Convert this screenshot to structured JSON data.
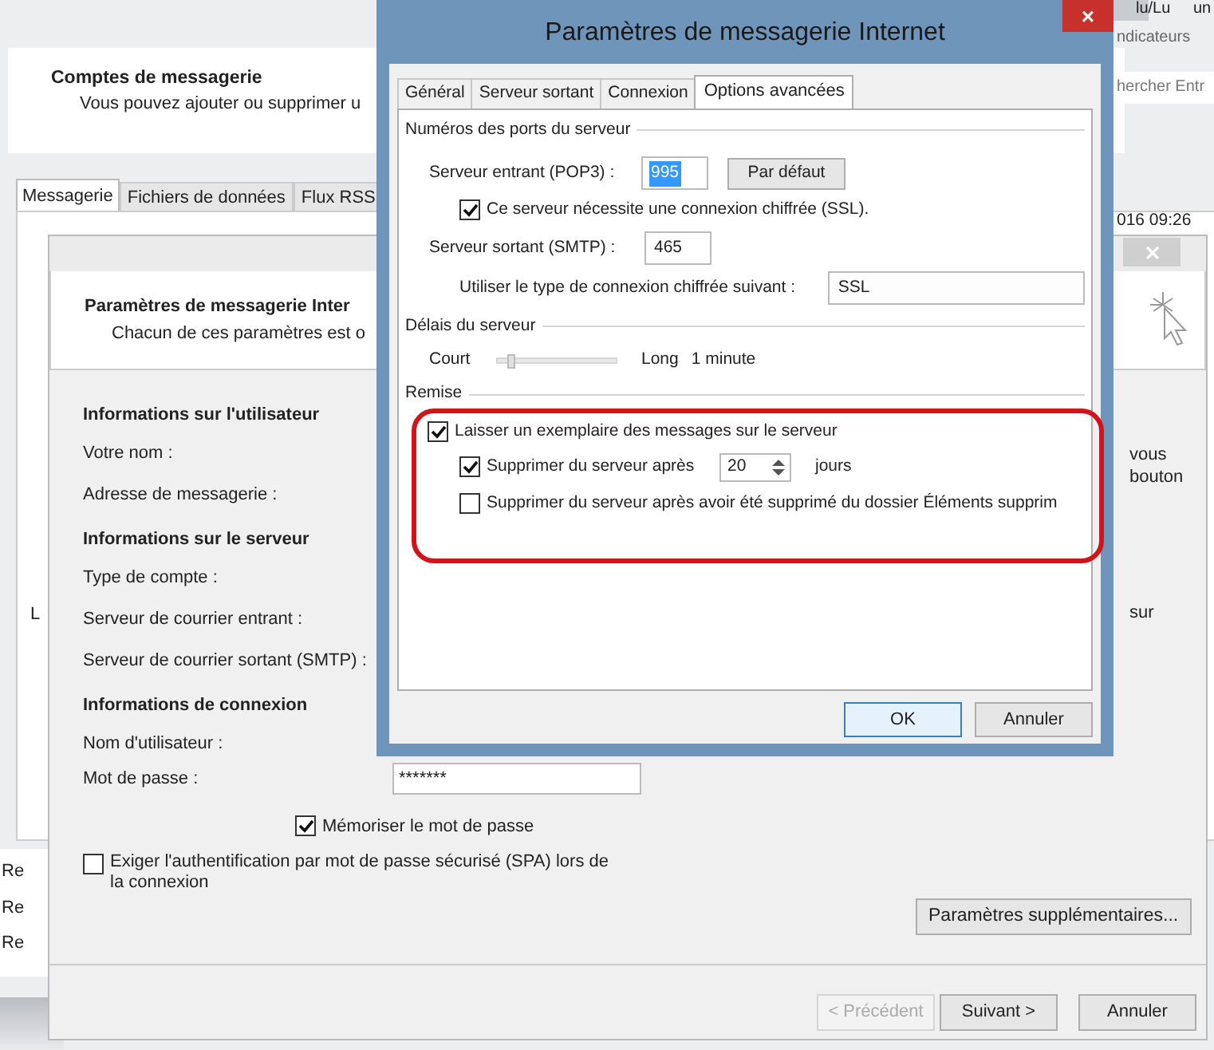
{
  "background_window": {
    "title": "Comptes de messagerie",
    "subtitle": "Vous pouvez ajouter ou supprimer u",
    "tabs": [
      {
        "label": "Messagerie",
        "selected": true
      },
      {
        "label": "Fichiers de données",
        "selected": false
      },
      {
        "label": "Flux RSS",
        "selected": false
      }
    ],
    "top_right": {
      "text_1": "lu/Lu",
      "text_2": "un",
      "text_3": "ndicateurs",
      "search_fragment": "hercher Entr",
      "date_fragment": "016 09:26"
    },
    "left_fragments": [
      "L"
    ],
    "list_fragments": [
      "Re",
      "Re",
      "Re"
    ]
  },
  "wizard": {
    "title": "Paramètres de messagerie Inter",
    "subtitle": "Chacun de ces paramètres est o",
    "sections": [
      {
        "heading": "Informations sur l'utilisateur",
        "labels": [
          "Votre nom :",
          "Adresse de messagerie :"
        ]
      },
      {
        "heading": "Informations sur le serveur",
        "labels": [
          "Type de compte :",
          "Serveur de courrier entrant :",
          "Serveur de courrier sortant (SMTP) :"
        ]
      },
      {
        "heading": "Informations de connexion",
        "labels": [
          "Nom d'utilisateur :"
        ]
      }
    ],
    "password": {
      "label": "Mot de passe :",
      "value": "*******"
    },
    "remember": {
      "label": "Mémoriser le mot de passe",
      "checked": true
    },
    "spa": {
      "label": "Exiger l'authentification par mot de passe sécurisé (SPA) lors de la connexion",
      "checked": false
    },
    "right_fragments": [
      "vous",
      "bouton",
      "sur"
    ],
    "more_settings_button": "Paramètres supplémentaires...",
    "buttons": [
      {
        "label": "< Précédent",
        "disabled": true
      },
      {
        "label": "Suivant >",
        "disabled": false
      },
      {
        "label": "Annuler",
        "disabled": false
      }
    ]
  },
  "dialog": {
    "title": "Paramètres de messagerie Internet",
    "close": "×",
    "tabs": [
      {
        "label": "Général",
        "selected": false
      },
      {
        "label": "Serveur sortant",
        "selected": false
      },
      {
        "label": "Connexion",
        "selected": false
      },
      {
        "label": "Options avancées",
        "selected": true
      }
    ],
    "ports": {
      "group": "Numéros des ports du serveur",
      "incoming_label": "Serveur entrant (POP3) :",
      "incoming_value": "995",
      "default_button": "Par défaut",
      "ssl": {
        "label": "Ce serveur nécessite une connexion chiffrée (SSL).",
        "checked": true
      },
      "outgoing_label": "Serveur sortant (SMTP) :",
      "outgoing_value": "465",
      "encryption_label": "Utiliser le type de connexion chiffrée suivant :",
      "encryption_value": "SSL"
    },
    "timeouts": {
      "group": "Délais du serveur",
      "min_label": "Court",
      "max_label": "Long",
      "level": 0.08,
      "reading": "1 minute"
    },
    "delivery": {
      "group": "Remise",
      "leave_copy": {
        "label": "Laisser un exemplaire des messages sur le serveur",
        "checked": true
      },
      "remove_after": {
        "label": "Supprimer du serveur après",
        "checked": true,
        "value": "20",
        "unit": "jours"
      },
      "remove_deleted": {
        "label": "Supprimer du serveur après avoir été supprimé du dossier Éléments supprim",
        "checked": false
      }
    },
    "buttons": [
      {
        "label": "OK",
        "default": true
      },
      {
        "label": "Annuler",
        "default": false
      }
    ]
  }
}
